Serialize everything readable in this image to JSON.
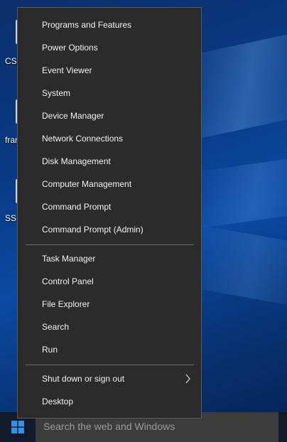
{
  "desktop": {
    "icons": [
      {
        "label": "CSh"
      },
      {
        "label": "fran"
      },
      {
        "label": "SS"
      }
    ]
  },
  "menu": {
    "group1": [
      "Programs and Features",
      "Power Options",
      "Event Viewer",
      "System",
      "Device Manager",
      "Network Connections",
      "Disk Management",
      "Computer Management",
      "Command Prompt",
      "Command Prompt (Admin)"
    ],
    "group2": [
      "Task Manager",
      "Control Panel",
      "File Explorer",
      "Search",
      "Run"
    ],
    "group3": [
      "Shut down or sign out",
      "Desktop"
    ],
    "submenu_indicator": "chevron-right-icon"
  },
  "taskbar": {
    "start_icon": "windows-logo-icon",
    "search_placeholder": "Search the web and Windows"
  },
  "colors": {
    "menu_bg": "#2b2b2b",
    "menu_text": "#f2f2f2",
    "taskbar_bg": "#101a2a",
    "search_bg": "#3c3c3c",
    "accent": "#3a8ee6"
  }
}
